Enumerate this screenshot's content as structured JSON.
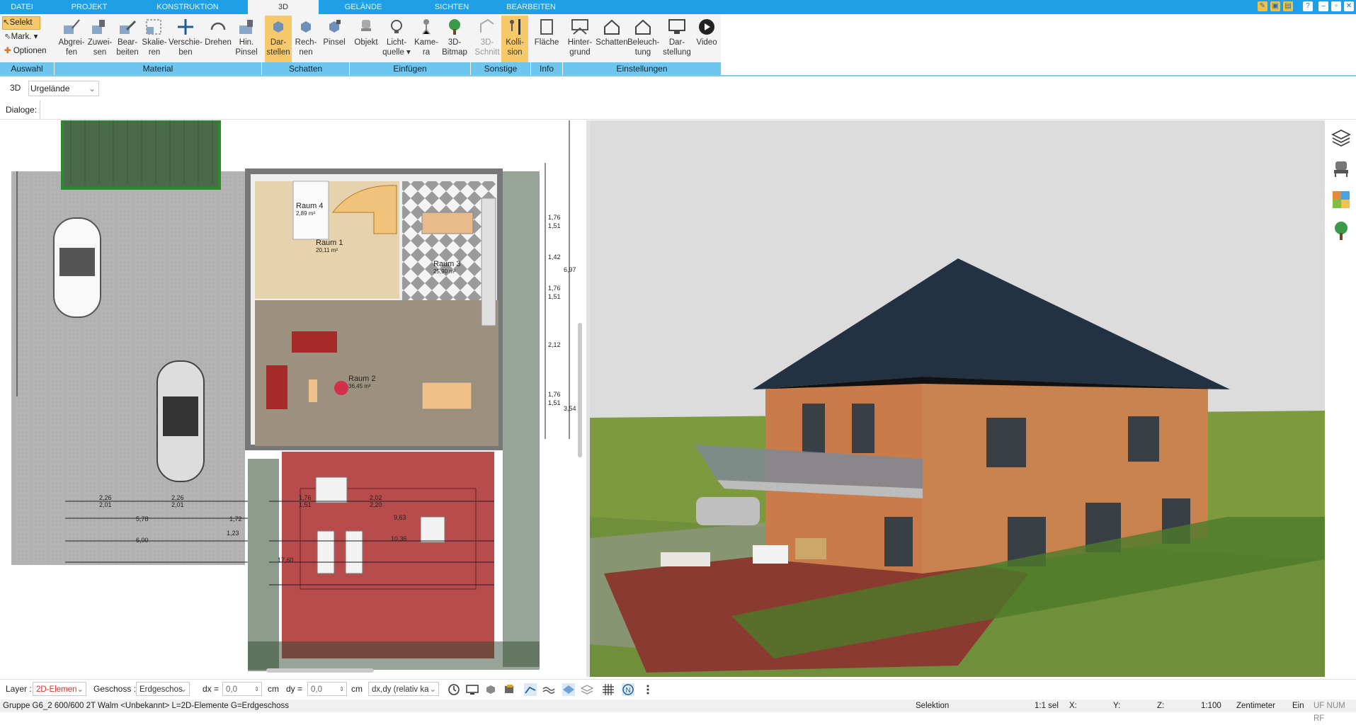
{
  "menu": {
    "tabs": [
      "DATEI",
      "PROJEKT",
      "KONSTRUKTION",
      "3D",
      "GELÄNDE",
      "SICHTEN",
      "BEARBEITEN"
    ],
    "active": "3D"
  },
  "ribbon": {
    "auswahl": {
      "select": "Selekt",
      "mark": "Mark. ▾",
      "options": "Optionen"
    },
    "buttons": [
      {
        "l1": "Abgrei-",
        "l2": "fen"
      },
      {
        "l1": "Zuwei-",
        "l2": "sen"
      },
      {
        "l1": "Bear-",
        "l2": "beiten"
      },
      {
        "l1": "Skalie-",
        "l2": "ren"
      },
      {
        "l1": "Verschie-",
        "l2": "ben"
      },
      {
        "l1": "Drehen",
        "l2": ""
      },
      {
        "l1": "Hin.",
        "l2": "Pinsel"
      },
      {
        "l1": "Dar-",
        "l2": "stellen"
      },
      {
        "l1": "Rech-",
        "l2": "nen"
      },
      {
        "l1": "Pinsel",
        "l2": ""
      },
      {
        "l1": "Objekt",
        "l2": ""
      },
      {
        "l1": "Licht-",
        "l2": "quelle ▾"
      },
      {
        "l1": "Kame-",
        "l2": "ra"
      },
      {
        "l1": "3D-",
        "l2": "Bitmap"
      },
      {
        "l1": "3D-",
        "l2": "Schnitt"
      },
      {
        "l1": "Kolli-",
        "l2": "sion"
      },
      {
        "l1": "Fläche",
        "l2": ""
      },
      {
        "l1": "Hinter-",
        "l2": "grund"
      },
      {
        "l1": "Schatten",
        "l2": ""
      },
      {
        "l1": "Beleuch-",
        "l2": "tung"
      },
      {
        "l1": "Dar-",
        "l2": "stellung"
      },
      {
        "l1": "Video",
        "l2": ""
      }
    ],
    "groups": [
      "Auswahl",
      "Material",
      "Schatten",
      "Einfügen",
      "Sonstige",
      "Info",
      "Einstellungen"
    ]
  },
  "toolbar": {
    "mode": "3D",
    "terrain": "Urgelände"
  },
  "dialogs_label": "Dialoge:",
  "plan": {
    "rooms": [
      {
        "name": "Raum 4",
        "area": "2,89 m²"
      },
      {
        "name": "Raum 1",
        "area": "20,11 m²"
      },
      {
        "name": "Raum 3",
        "area": "25,90 m²"
      },
      {
        "name": "Raum 2",
        "area": "36,45 m²"
      }
    ],
    "dims": [
      "2,26",
      "2,01",
      "2,26",
      "2,01",
      "5,78",
      "1,72",
      "6,00",
      "1,23",
      "1,76",
      "1,51",
      "2,02",
      "2,20",
      "9,63",
      "10,36",
      "17,60",
      "1,76",
      "1,51",
      "1,42",
      "1,76",
      "1,51",
      "2,12",
      "1,76",
      "1,51",
      "3,54",
      "6,97"
    ]
  },
  "bottom": {
    "layer_label": "Layer :",
    "layer_value": "2D-Elemen",
    "geschoss_label": "Geschoss :",
    "geschoss_value": "Erdgeschos",
    "dx_label": "dx =",
    "dx_value": "0,0",
    "dx_unit": "cm",
    "dy_label": "dy =",
    "dy_value": "0,0",
    "dy_unit": "cm",
    "rel_value": "dx,dy (relativ ka"
  },
  "status": {
    "info": "Gruppe G6_2 600/600 2T Walm <Unbekannt> L=2D-Elemente G=Erdgeschoss",
    "mode": "Selektion",
    "sel": "1:1 sel",
    "x": "X:",
    "y": "Y:",
    "z": "Z:",
    "scale": "1:100",
    "unit": "Zentimeter",
    "ein": "Ein",
    "flags": "UF NUM RF"
  },
  "colors": {
    "accent": "#1f9fe6",
    "group_bar": "#6ec6ee",
    "active_button": "#f7c96a"
  }
}
